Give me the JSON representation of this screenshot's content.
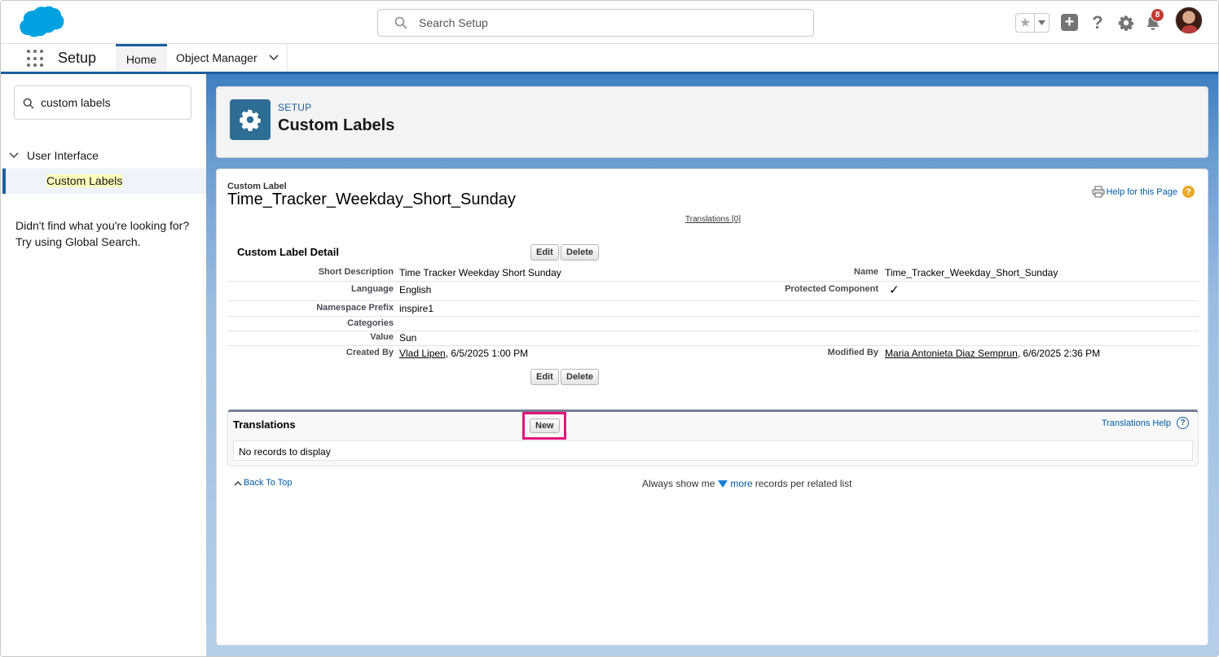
{
  "header": {
    "search_placeholder": "Search Setup",
    "notification_count": "8",
    "help_glyph": "?"
  },
  "nav": {
    "app_name": "Setup",
    "tabs": [
      {
        "label": "Home",
        "active": true
      },
      {
        "label": "Object Manager",
        "active": false
      }
    ]
  },
  "sidebar": {
    "quickfind_value": "custom labels",
    "tree": {
      "parent": "User Interface",
      "child": "Custom Labels"
    },
    "not_found_text": "Didn't find what you're looking for? Try using Global Search."
  },
  "page_header": {
    "kicker": "SETUP",
    "title": "Custom Labels",
    "icon": "gear-icon"
  },
  "record": {
    "type_label": "Custom Label",
    "title": "Time_Tracker_Weekday_Short_Sunday",
    "help_link": "Help for this Page",
    "translations_link": "Translations",
    "translations_count": "[0]"
  },
  "detail": {
    "section_title": "Custom Label Detail",
    "edit_label": "Edit",
    "delete_label": "Delete",
    "fields": {
      "short_description": {
        "label": "Short Description",
        "value": "Time Tracker Weekday Short Sunday"
      },
      "name": {
        "label": "Name",
        "value": "Time_Tracker_Weekday_Short_Sunday"
      },
      "language": {
        "label": "Language",
        "value": "English"
      },
      "protected_component": {
        "label": "Protected Component",
        "value": "✓"
      },
      "namespace_prefix": {
        "label": "Namespace Prefix",
        "value": "inspire1"
      },
      "categories": {
        "label": "Categories",
        "value": ""
      },
      "value": {
        "label": "Value",
        "value": "Sun"
      },
      "created_by": {
        "label": "Created By",
        "user": "Vlad Lipen",
        "date": ", 6/5/2025 1:00 PM"
      },
      "modified_by": {
        "label": "Modified By",
        "user": "Maria Antonieta Diaz Semprun",
        "date": ", 6/6/2025 2:36 PM"
      }
    }
  },
  "translations_list": {
    "title": "Translations",
    "new_label": "New",
    "help_link": "Translations Help",
    "empty_text": "No records to display"
  },
  "footer": {
    "back_to_top": "Back To Top",
    "always_show_prefix": "Always show me",
    "more_link": "more",
    "always_show_suffix": "records per related list"
  },
  "colors": {
    "brand_blue": "#1b5f9e",
    "highlight_pink": "#e3157c",
    "badge_red": "#c23934",
    "help_orange": "#eaa92c"
  }
}
